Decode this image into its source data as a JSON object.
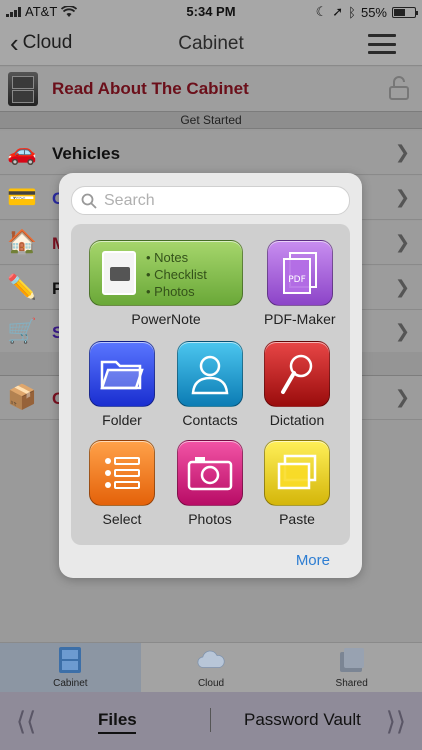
{
  "status_bar": {
    "carrier": "AT&T",
    "time": "5:34 PM",
    "battery_percent": "55%",
    "battery_level": 0.55
  },
  "nav": {
    "back_label": "Cloud",
    "title": "Cabinet"
  },
  "cabinet": {
    "title": "Read About The Cabinet",
    "get_started": "Get Started"
  },
  "list": {
    "items": [
      {
        "icon": "car-icon",
        "label": "Vehicles",
        "color": "#111111"
      },
      {
        "icon": "credit-card-icon",
        "label": "C",
        "color": "#2a2aa0"
      },
      {
        "icon": "house-icon",
        "label": "M",
        "color": "#7a1020"
      },
      {
        "icon": "pencil-icon",
        "label": "P",
        "color": "#111111"
      },
      {
        "icon": "shopping-cart-icon",
        "label": "S",
        "color": "#3a1a8a"
      },
      {
        "icon": "box-icon",
        "label": "C",
        "color": "#7a1020"
      }
    ]
  },
  "popover": {
    "search_placeholder": "Search",
    "powernote_lines": [
      "Notes",
      "Checklist",
      "Photos"
    ],
    "apps": [
      {
        "label": "PowerNote",
        "icon": "powernote-icon"
      },
      {
        "label": "PDF-Maker",
        "icon": "pdf-icon",
        "tile_text": "PDF"
      },
      {
        "label": "Folder",
        "icon": "folder-icon"
      },
      {
        "label": "Contacts",
        "icon": "contacts-icon"
      },
      {
        "label": "Dictation",
        "icon": "microphone-icon"
      },
      {
        "label": "Select",
        "icon": "list-icon"
      },
      {
        "label": "Photos",
        "icon": "camera-icon"
      },
      {
        "label": "Paste",
        "icon": "paste-icon"
      }
    ],
    "more_label": "More"
  },
  "tab_bar": {
    "tabs": [
      {
        "label": "Cabinet",
        "icon": "cabinet-icon",
        "active": true
      },
      {
        "label": "Cloud",
        "icon": "cloud-icon",
        "active": false
      },
      {
        "label": "Shared",
        "icon": "shared-icon",
        "active": false
      }
    ]
  },
  "segment_bar": {
    "files_label": "Files",
    "vault_label": "Password Vault"
  }
}
